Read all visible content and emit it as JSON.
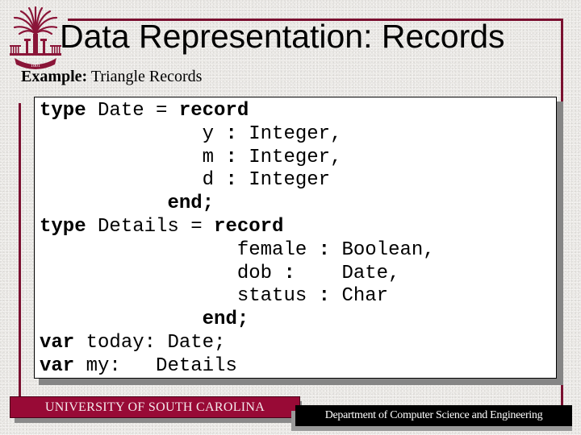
{
  "slide": {
    "title": "Data Representation: Records",
    "subtitle_label": "Example:",
    "subtitle_text": " Triangle Records",
    "logo_icon": "usc-palmetto-seal-icon",
    "logo_year": "1801"
  },
  "code": {
    "lines": [
      [
        {
          "t": "type",
          "kw": true
        },
        {
          "t": " Date = "
        },
        {
          "t": "record",
          "kw": true
        }
      ],
      [
        {
          "t": "              y "
        },
        {
          "t": ":",
          "kw": true
        },
        {
          "t": " Integer,"
        }
      ],
      [
        {
          "t": "              m "
        },
        {
          "t": ":",
          "kw": true
        },
        {
          "t": " Integer,"
        }
      ],
      [
        {
          "t": "              d "
        },
        {
          "t": ":",
          "kw": true
        },
        {
          "t": " Integer"
        }
      ],
      [
        {
          "t": "           "
        },
        {
          "t": "end;",
          "kw": true
        }
      ],
      [
        {
          "t": "type",
          "kw": true
        },
        {
          "t": " Details = "
        },
        {
          "t": "record",
          "kw": true
        }
      ],
      [
        {
          "t": "                 female "
        },
        {
          "t": ":",
          "kw": true
        },
        {
          "t": " Boolean,"
        }
      ],
      [
        {
          "t": "                 dob "
        },
        {
          "t": ":",
          "kw": true
        },
        {
          "t": "    Date,"
        }
      ],
      [
        {
          "t": "                 status "
        },
        {
          "t": ":",
          "kw": true
        },
        {
          "t": " Char"
        }
      ],
      [
        {
          "t": "              "
        },
        {
          "t": "end;",
          "kw": true
        }
      ],
      [
        {
          "t": "var",
          "kw": true
        },
        {
          "t": " today: Date;"
        }
      ],
      [
        {
          "t": "var",
          "kw": true
        },
        {
          "t": " my:   Details"
        }
      ]
    ]
  },
  "footer": {
    "university": "UNIVERSITY OF SOUTH CAROLINA",
    "department": "Department of Computer Science and Engineering"
  },
  "colors": {
    "maroon": "#980a36",
    "frame": "#7a1030",
    "black": "#000000"
  }
}
